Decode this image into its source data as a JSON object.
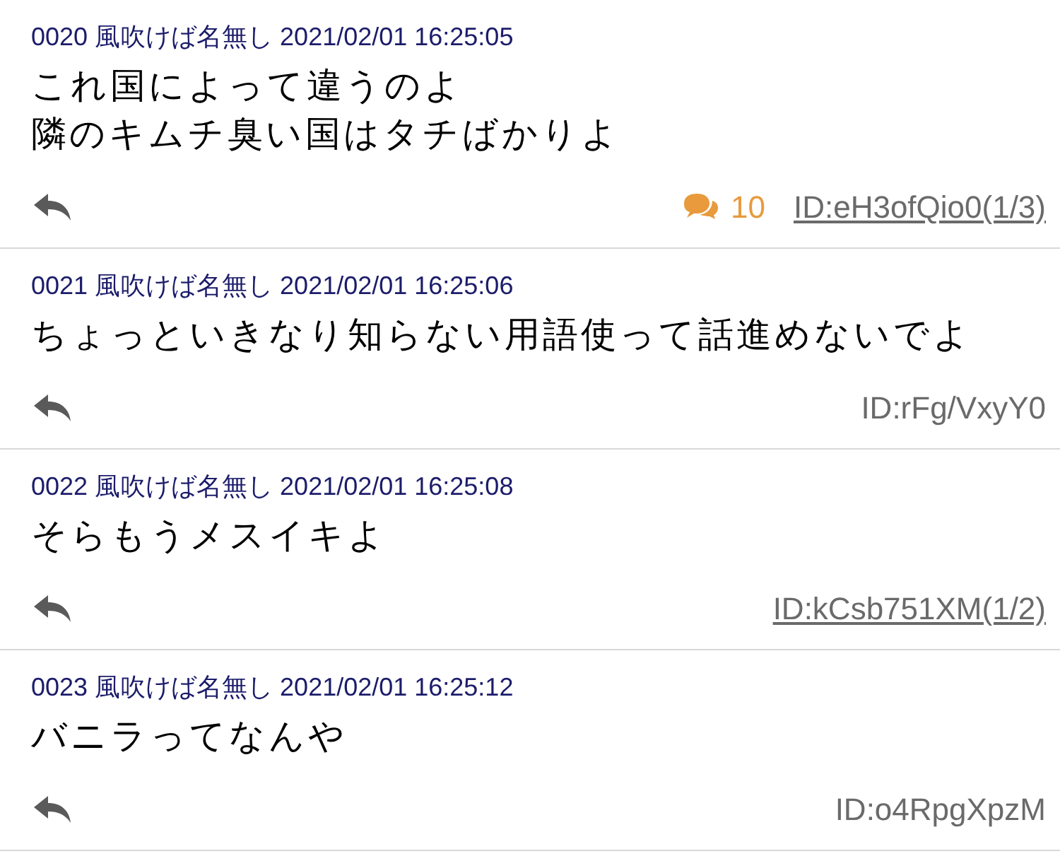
{
  "posts": [
    {
      "number": "0020",
      "name": "風吹けば名無し",
      "date": "2021/02/01 16:25:05",
      "text": [
        "これ国によって違うのよ",
        "隣のキムチ臭い国はタチばかりよ"
      ],
      "reply_count": "10",
      "id": "ID:eH3ofQio0(1/3)",
      "id_linked": true
    },
    {
      "number": "0021",
      "name": "風吹けば名無し",
      "date": "2021/02/01 16:25:06",
      "text": [
        "ちょっといきなり知らない用語使って話進めないでよ"
      ],
      "id": "ID:rFg/VxyY0",
      "id_linked": false
    },
    {
      "number": "0022",
      "name": "風吹けば名無し",
      "date": "2021/02/01 16:25:08",
      "text": [
        "そらもうメスイキよ"
      ],
      "id": "ID:kCsb751XM(1/2)",
      "id_linked": true
    },
    {
      "number": "0023",
      "name": "風吹けば名無し",
      "date": "2021/02/01 16:25:12",
      "text": [
        "バニラってなんや"
      ],
      "id": "ID:o4RpgXpzM",
      "id_linked": false
    }
  ]
}
